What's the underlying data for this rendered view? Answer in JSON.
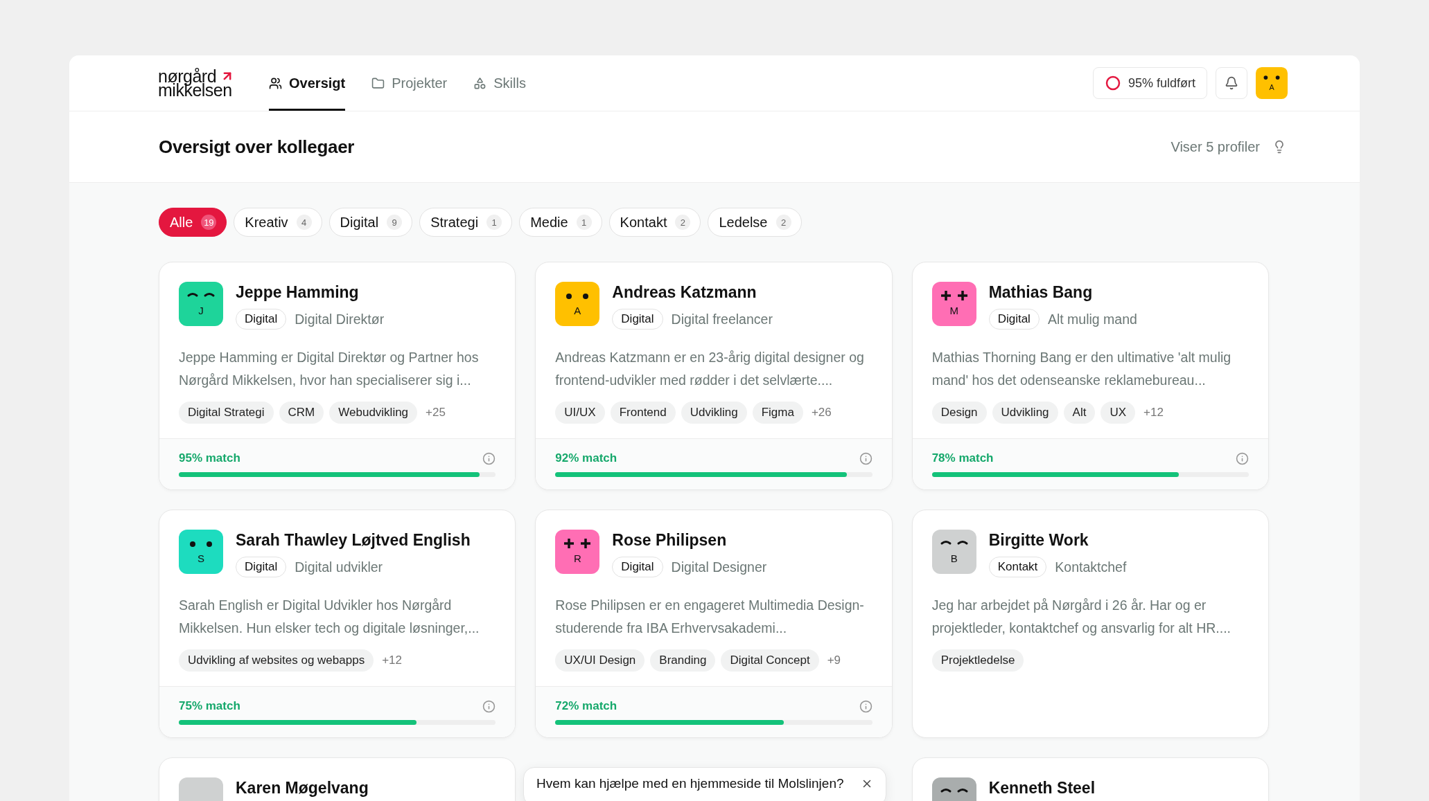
{
  "logo": {
    "line1": "nørgård",
    "line2": "mikkelsen"
  },
  "nav": [
    {
      "label": "Oversigt",
      "selected": true
    },
    {
      "label": "Projekter",
      "selected": false
    },
    {
      "label": "Skills",
      "selected": false
    }
  ],
  "completion": {
    "label": "95% fuldført"
  },
  "user_avatar": {
    "letter": "A",
    "color": "#ffc000",
    "kind": "dots"
  },
  "page_title": "Oversigt over kollegaer",
  "profile_count": "Viser 5 profiler",
  "filters": [
    {
      "label": "Alle",
      "count": "19",
      "selected": true
    },
    {
      "label": "Kreativ",
      "count": "4",
      "selected": false
    },
    {
      "label": "Digital",
      "count": "9",
      "selected": false
    },
    {
      "label": "Strategi",
      "count": "1",
      "selected": false
    },
    {
      "label": "Medie",
      "count": "1",
      "selected": false
    },
    {
      "label": "Kontakt",
      "count": "2",
      "selected": false
    },
    {
      "label": "Ledelse",
      "count": "2",
      "selected": false
    }
  ],
  "profiles": [
    {
      "name": "Jeppe Hamming",
      "avatar": {
        "letter": "J",
        "color": "#1ed49a",
        "kind": "arcs"
      },
      "department": "Digital",
      "role": "Digital Direktør",
      "description": "Jeppe Hamming er Digital Direktør og Partner hos Nørgård Mikkelsen, hvor han specialiserer sig i...",
      "skills": [
        "Digital Strategi",
        "CRM",
        "Webudvikling"
      ],
      "more_skills": "+25",
      "match": {
        "label": "95% match",
        "level": 0.95
      }
    },
    {
      "name": "Andreas Katzmann",
      "avatar": {
        "letter": "A",
        "color": "#ffc000",
        "kind": "dots"
      },
      "department": "Digital",
      "role": "Digital freelancer",
      "description": "Andreas Katzmann er en 23-årig digital designer og frontend-udvikler med rødder i det selvlærte....",
      "skills": [
        "UI/UX",
        "Frontend",
        "Udvikling",
        "Figma"
      ],
      "more_skills": "+26",
      "match": {
        "label": "92% match",
        "level": 0.92
      }
    },
    {
      "name": "Mathias Bang",
      "avatar": {
        "letter": "M",
        "color": "#ff6eb4",
        "kind": "plus"
      },
      "department": "Digital",
      "role": "Alt mulig mand",
      "description": "Mathias Thorning Bang er den ultimative 'alt mulig mand' hos det odenseanske reklamebureau...",
      "skills": [
        "Design",
        "Udvikling",
        "Alt",
        "UX"
      ],
      "more_skills": "+12",
      "match": {
        "label": "78% match",
        "level": 0.78
      }
    },
    {
      "name": "Sarah Thawley Løjtved English",
      "avatar": {
        "letter": "S",
        "color": "#1ddcbf",
        "kind": "dots"
      },
      "department": "Digital",
      "role": "Digital udvikler",
      "description": "Sarah English er Digital Udvikler hos Nørgård Mikkelsen. Hun elsker tech og digitale løsninger,...",
      "skills": [
        "Udvikling af websites og webapps"
      ],
      "more_skills": "+12",
      "match": {
        "label": "75% match",
        "level": 0.75
      }
    },
    {
      "name": "Rose Philipsen",
      "avatar": {
        "letter": "R",
        "color": "#ff6eb4",
        "kind": "plus"
      },
      "department": "Digital",
      "role": "Digital Designer",
      "description": "Rose Philipsen er en engageret Multimedia Design-studerende fra IBA Erhvervsakademi...",
      "skills": [
        "UX/UI Design",
        "Branding",
        "Digital Concept"
      ],
      "more_skills": "+9",
      "match": {
        "label": "72% match",
        "level": 0.72
      }
    },
    {
      "name": "Birgitte Work",
      "avatar": {
        "letter": "B",
        "color": "#cfd1d1",
        "kind": "arcs"
      },
      "department": "Kontakt",
      "role": "Kontaktchef",
      "description": "Jeg har arbejdet på Nørgård i 26 år. Har og er projektleder, kontaktchef og ansvarlig for alt HR....",
      "skills": [
        "Projektledelse"
      ]
    },
    {
      "name": "Karen Møgelvang",
      "avatar": {
        "color": "#cfd1d1",
        "kind": "none"
      }
    },
    {
      "name": "Kenneth Steel",
      "avatar": {
        "color": "#a9adad",
        "kind": "arcs"
      }
    }
  ],
  "chat_prompt": {
    "text": "Hvem kan hjælpe med en hjemmeside til Molslinjen?"
  }
}
